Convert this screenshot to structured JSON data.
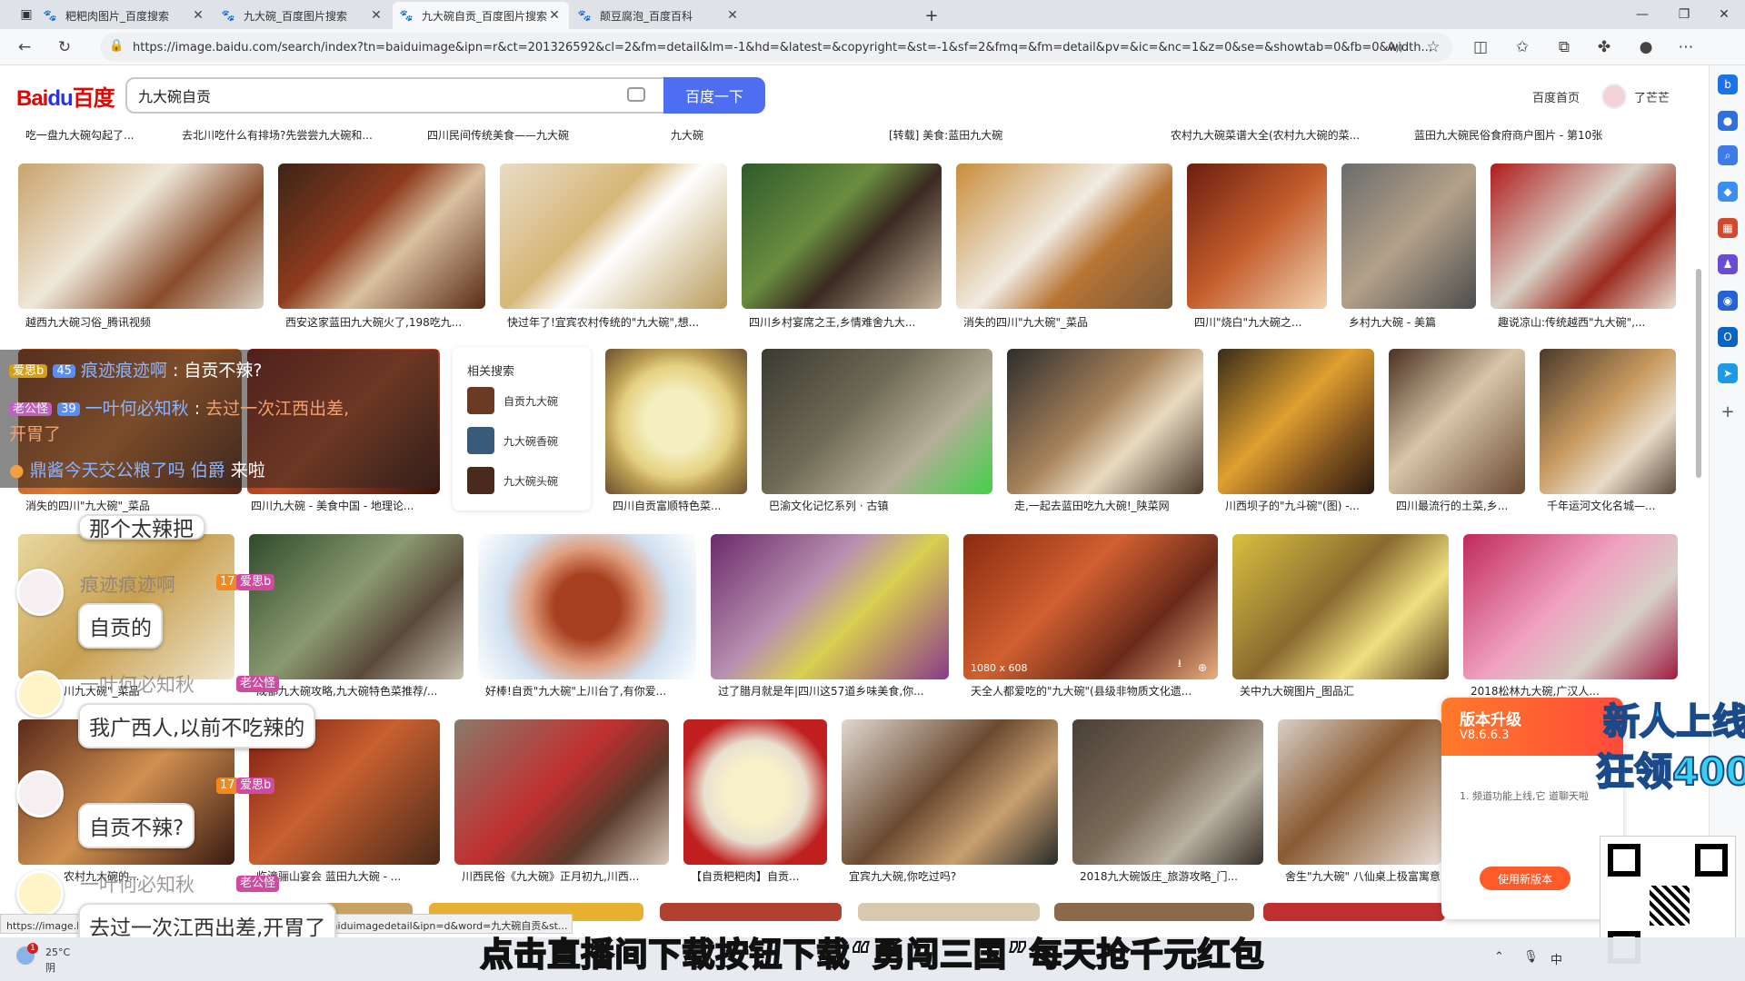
{
  "browser": {
    "tabs": [
      {
        "title": "粑粑肉图片_百度搜索"
      },
      {
        "title": "九大碗_百度图片搜索"
      },
      {
        "title": "九大碗自贡_百度图片搜索"
      },
      {
        "title": "颠豆腐泡_百度百科"
      }
    ],
    "new_tab": "+",
    "url": "https://image.baidu.com/search/index?tn=baiduimage&ipn=r&ct=201326592&cl=2&fm=detail&lm=-1&hd=&latest=&copyright=&st=-1&sf=2&fmq=&fm=detail&pv=&ic=&nc=1&z=0&se=&showtab=0&fb=0&width...",
    "status_url": "https://image.baidu.com/search/detail?ct=503316480&z=&tn=baiduimagedetail&ipn=d&word=九大碗自贡&st..."
  },
  "header": {
    "logo_text": "Bai",
    "logo_paw": "du",
    "logo_cn": "百度",
    "search_value": "九大碗自贡",
    "search_button": "百度一下",
    "home_link": "百度首页",
    "username": "了芒芒"
  },
  "top_captions": [
    "吃一盘九大碗勾起了...",
    "去北川吃什么有排场?先尝尝九大碗和...",
    "四川民间传统美食——九大碗",
    "九大碗",
    "[转载] 美食:蓝田九大碗",
    "农村九大碗菜谱大全(农村九大碗的菜...",
    "蓝田九大碗民俗食府商户图片 - 第10张"
  ],
  "row1": [
    "越西九大碗习俗_腾讯视频",
    "西安这家蓝田九大碗火了,198吃九...",
    "快过年了!宜宾农村传统的\"九大碗\",想...",
    "四川乡村宴席之王,乡情难舍九大...",
    "消失的四川\"九大碗\"_菜品",
    "四川\"烧白\"九大碗之...",
    "乡村九大碗 - 美篇",
    "趣说凉山:传统越西\"九大碗\",..."
  ],
  "row2": [
    "消失的四川\"九大碗\"_菜品",
    "四川九大碗 - 美食中国 - 地理论...",
    "四川自贡富顺特色菜...",
    "巴渝文化记忆系列 · 古镇",
    "走,一起去蓝田吃九大碗!_陕菜网",
    "川西坝子的\"九斗碗\"(图) -...",
    "四川最流行的土菜,乡...",
    "千年运河文化名城—..."
  ],
  "row3": [
    "川九大碗\"_菜品",
    "成都九大碗攻略,九大碗特色菜推荐/...",
    "好棒!自贡\"九大碗\"上川台了,有你爱...",
    "过了腊月就是年|四川这57道乡味美食,你...",
    "天全人都爱吃的\"九大碗\"(县级非物质文化遗...",
    "关中九大碗图片_图品汇",
    "2018松林九大碗,广汉人..."
  ],
  "row4": [
    "农村九大碗的...",
    "临潼骊山宴会 蓝田九大碗 - ...",
    "川西民俗《九大碗》正月初九,川西...",
    "【自贡粑粑肉】自贡...",
    "宜宾九大碗,你吃过吗?",
    "2018九大碗饭庄_旅游攻略_门...",
    "舍生\"九大碗\" 八仙桌上极富寓意"
  ],
  "hover_dim": "1080 x 608",
  "related": {
    "title": "相关搜索",
    "items": [
      "自贡九大碗",
      "九大碗香碗",
      "九大碗头碗"
    ]
  },
  "chat": {
    "line1_name": "痕迹痕迹啊",
    "line1_sep": ":",
    "line1_msg": "自贡不辣?",
    "line1_level": "45",
    "line1_fan": "爱思b",
    "line2_name": "一叶何必知秋",
    "line2_sep": ":",
    "line2_msg": "去过一次江西出差,",
    "line2_msg2": "开胃了",
    "line2_level": "39",
    "line2_fan": "老公怪",
    "line3_a": "鼎酱今天交公粮了吗",
    "line3_b": "伯爵",
    "line3_c": "来啦",
    "bubbles": [
      "那个太辣把",
      "自贡的",
      "我广西人,以前不吃辣的",
      "自贡不辣?",
      "去过一次江西出差,开胃了"
    ],
    "ghost_names": [
      "痕迹痕迹啊",
      "一叶何必知秋",
      "一叶何必知秋"
    ],
    "badges": [
      "爱思b",
      "老公怪",
      "爱思b",
      "老公怪"
    ],
    "levels": [
      "17",
      "17"
    ]
  },
  "ad": {
    "title": "版本升级",
    "version": "V8.6.6.3",
    "body": "1. 频道功能上线,它 道聊天啦",
    "button": "使用新版本",
    "promo1": "新人上线",
    "promo2": "狂领400"
  },
  "subtitle": "点击直播间下载按钮下载“勇闯三国”每天抢千元红包",
  "taskbar": {
    "temp": "25°C",
    "weather": "阴",
    "ime": "中"
  }
}
